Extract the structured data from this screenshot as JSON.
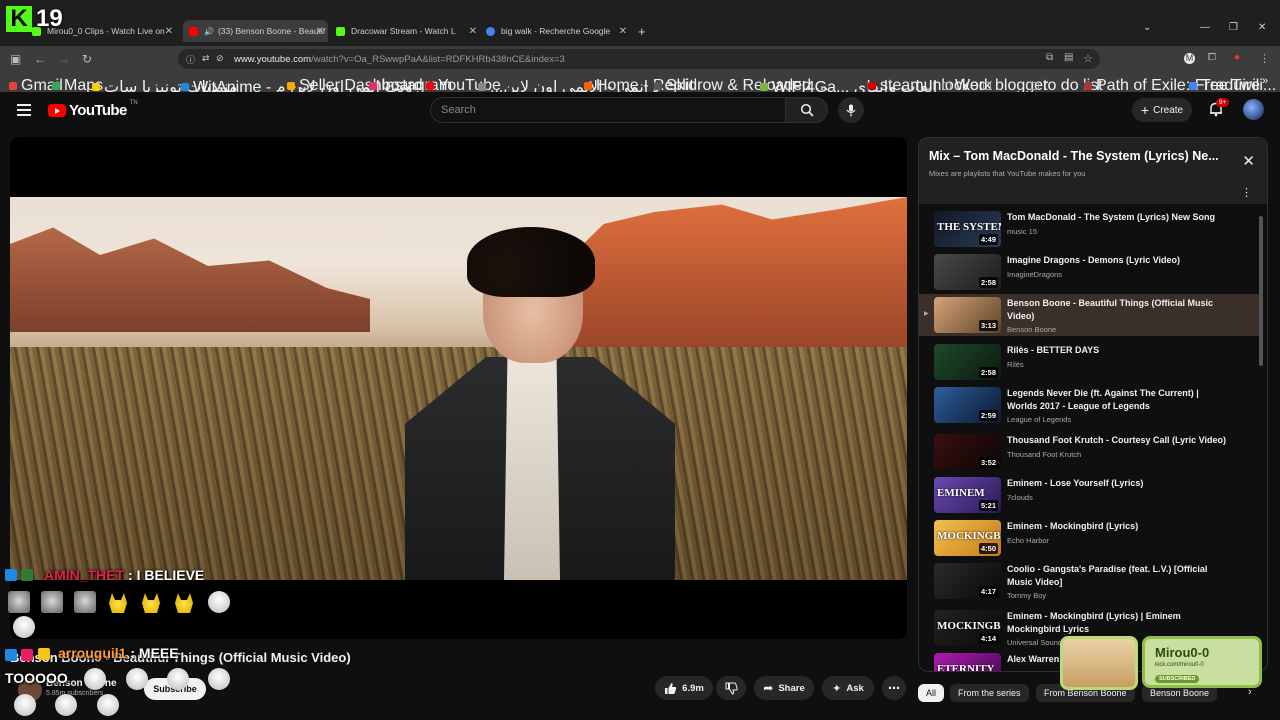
{
  "overlay": {
    "badge": "K",
    "number": "19"
  },
  "tabs": [
    {
      "label": "Mirou0_0 Clips - Watch Live on",
      "color": "#53fc18"
    },
    {
      "label": "(33) Benson Boone - Beautif",
      "color": "#ff0000"
    },
    {
      "label": "Dracowar Stream - Watch L",
      "color": "#53fc18"
    },
    {
      "label": "big walk - Recherche Google",
      "color": "#4285f4"
    }
  ],
  "address": {
    "host": "www.youtube.com",
    "path": "/watch?v=Oa_RSwwpPaA&list=RDFKHRb438nCE&index=3"
  },
  "bookmarks": [
    {
      "label": "Gmail",
      "color": "#ea4335"
    },
    {
      "label": "Maps",
      "color": "#34a853"
    },
    {
      "label": "منتديات تونيزيا سات",
      "color": "#ffcc00"
    },
    {
      "label": "WitAnime - ويت انمي اون لاين م",
      "color": "#1e88e5"
    },
    {
      "label": "Seller Dashboard",
      "color": "#f9ab00"
    },
    {
      "label": "Instagram",
      "color": "#e1306c"
    },
    {
      "label": "YouTube",
      "color": "#ff0000"
    },
    {
      "label": "...د انمي - الانمي اون لاين",
      "color": "#888888"
    },
    {
      "label": "Home - Replit",
      "color": "#f26207"
    },
    {
      "label": "Skidrow & Reloaded ...",
      "color": "#555555"
    },
    {
      "label": "WIFI4Ga... العاب وايفاي",
      "color": "#7cb342"
    },
    {
      "label": "steamunlocked",
      "color": "#cc0000"
    },
    {
      "label": "Work",
      "color": "#aaaaaa"
    },
    {
      "label": "blogger",
      "color": "#aaaaaa"
    },
    {
      "label": "to do list",
      "color": "#aaaaaa"
    },
    {
      "label": "Path of Exile: Free Twili...",
      "color": "#a33"
    },
    {
      "label": "Traduire",
      "color": "#4285f4"
    }
  ],
  "yt": {
    "logo_text": "YouTube",
    "logo_region": "TN",
    "search_placeholder": "Search",
    "create_label": "Create",
    "notif_badge": "9+"
  },
  "playlist": {
    "title": "Mix – Tom MacDonald - The System (Lyrics) Ne...",
    "subtitle": "Mixes are playlists that YouTube makes for you",
    "items": [
      {
        "title": "Tom MacDonald - The System (Lyrics) New Song",
        "channel": "music 15",
        "duration": "4:49",
        "thumb_text": "THE SYSTEM",
        "c1": "#101828",
        "c2": "#2a3b55"
      },
      {
        "title": "Imagine Dragons - Demons (Lyric Video)",
        "channel": "ImagineDragons",
        "duration": "2:58",
        "thumb_text": "",
        "c1": "#4a4a4a",
        "c2": "#1c1c1c"
      },
      {
        "title": "Benson Boone - Beautiful Things (Official Music Video)",
        "channel": "Benson Boone",
        "duration": "3:13",
        "thumb_text": "",
        "c1": "#d9a27a",
        "c2": "#5a4527",
        "current": true
      },
      {
        "title": "Rilès - BETTER DAYS",
        "channel": "Rilès",
        "duration": "2:58",
        "thumb_text": "",
        "c1": "#1e4a2a",
        "c2": "#0b1a10"
      },
      {
        "title": "Legends Never Die (ft. Against The Current) | Worlds 2017 - League of Legends",
        "channel": "League of Legends",
        "duration": "2:59",
        "thumb_text": "",
        "c1": "#2d5f9a",
        "c2": "#0b1730"
      },
      {
        "title": "Thousand Foot Krutch - Courtesy Call (Lyric Video)",
        "channel": "Thousand Foot Krutch",
        "duration": "3:52",
        "thumb_text": "",
        "c1": "#3a1010",
        "c2": "#0c0505"
      },
      {
        "title": "Eminem - Lose Yourself (Lyrics)",
        "channel": "7clouds",
        "duration": "5:21",
        "thumb_text": "EMINEM",
        "c1": "#6a4ab0",
        "c2": "#2a1a55"
      },
      {
        "title": "Eminem - Mockingbird (Lyrics)",
        "channel": "Echo Harbor",
        "duration": "4:50",
        "thumb_text": "MOCKINGBIRD",
        "c1": "#f2c14e",
        "c2": "#c47a1a"
      },
      {
        "title": "Coolio - Gangsta's Paradise (feat. L.V.) [Official Music Video]",
        "channel": "Tommy Boy",
        "duration": "4:17",
        "thumb_text": "",
        "c1": "#2a2a2a",
        "c2": "#0a0a0a"
      },
      {
        "title": "Eminem - Mockingbird (Lyrics) | Eminem Mockingbird Lyrics",
        "channel": "Universal Sound",
        "duration": "4:14",
        "thumb_text": "MOCKINGBIRD",
        "c1": "#222222",
        "c2": "#0a0a0a"
      },
      {
        "title": "Alex Warren -",
        "channel": "",
        "duration": "",
        "thumb_text": "ETERNITY",
        "c1": "#b01ab0",
        "c2": "#400a50"
      }
    ]
  },
  "video": {
    "title": "Benson Boone - Beautiful Things (Official Music Video)",
    "channel": "Benson Boone",
    "subscribers": "5.85m subscribers",
    "subscribe_label": "Subscribe",
    "likes": "6.9m",
    "share_label": "Share",
    "ask_label": "Ask"
  },
  "chips": [
    "All",
    "From the series",
    "From Benson Boone",
    "Benson Boone"
  ],
  "chat": [
    {
      "user": "AMIN_THET",
      "user_color": "#e0204a",
      "message": " : I BELIEVE"
    },
    {
      "user": "arrouguil1",
      "user_color": "#ff9a3c",
      "message": " : MEEE"
    },
    {
      "user": "",
      "user_color": "#ffffff",
      "message": "TOOOOO"
    }
  ],
  "sub_widget": {
    "name": "Mirou0-0",
    "url": "kick.com/mirou0-0",
    "status": "SUBSCRIBED"
  }
}
